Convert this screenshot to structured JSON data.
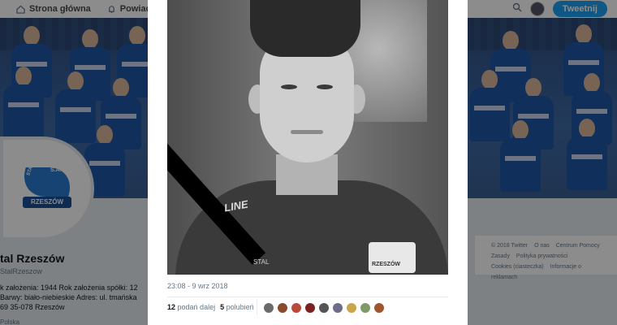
{
  "nav": {
    "home_label": "Strona główna",
    "notifications_label": "Powiadomienia",
    "tweet_button": "Tweetnij"
  },
  "profile": {
    "name": "tal Rzeszów",
    "handle": "StalRzeszow",
    "bio": "k założenia: 1944 Rok założenia spółki: 12 Barwy: biało-niebieskie Adres: ul. tmańska 69 35-078 Rzeszów",
    "location": "Polska",
    "logo_text": "RZESZÓW",
    "logo_sa": "S.A.",
    "logo_stal": "STAL"
  },
  "footer": {
    "line1": [
      "© 2018 Twitter",
      "O nas",
      "Centrum Pomocy"
    ],
    "line2": [
      "Zasady",
      "Polityka prywatności"
    ],
    "line3": [
      "Cookies (ciasteczka)",
      "Informacje o reklamach"
    ]
  },
  "tweet": {
    "timestamp": "23:08 - 9 wrz 2018",
    "retweets_count": "12",
    "retweets_label": "podań dalej",
    "likes_count": "5",
    "likes_label": "polubień",
    "photo_brand": "LINE",
    "photo_crest": "RZESZÓW",
    "photo_crest_top": "STAL",
    "photo_sponsor": "STAL"
  },
  "likers": [
    {
      "color": "#6b6b6b"
    },
    {
      "color": "#8a4a2e"
    },
    {
      "color": "#b84b3c"
    },
    {
      "color": "#7a2222"
    },
    {
      "color": "#545454"
    },
    {
      "color": "#6d6d8a"
    },
    {
      "color": "#c9a54b"
    },
    {
      "color": "#7e9a6a"
    },
    {
      "color": "#a0552d"
    }
  ],
  "colors": {
    "accent": "#1da1f2",
    "background": "#e6ecf0"
  }
}
